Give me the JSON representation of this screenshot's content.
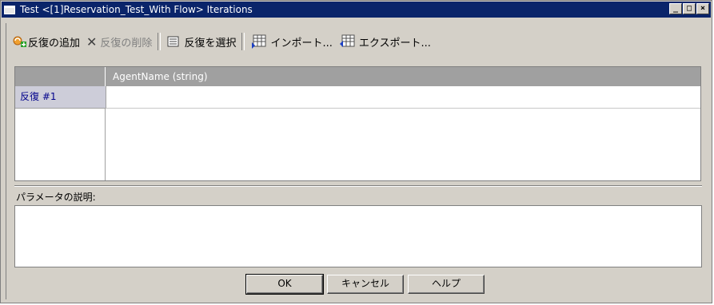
{
  "window": {
    "title": "Test <[1]Reservation_Test_With Flow> Iterations",
    "controls": {
      "minimize": "_",
      "maximize": "□",
      "close": "×"
    }
  },
  "toolbar": {
    "add_iteration": "反復の追加",
    "delete_iteration": "反復の削除",
    "select_iteration": "反復を選択",
    "import": "インポート...",
    "export": "エクスポート..."
  },
  "grid": {
    "columns": [
      "AgentName (string)"
    ],
    "rows": [
      {
        "label": "反復 #1",
        "values": [
          ""
        ]
      }
    ]
  },
  "description": {
    "label": "パラメータの説明:",
    "value": ""
  },
  "buttons": {
    "ok": "OK",
    "cancel": "キャンセル",
    "help": "ヘルプ"
  },
  "colors": {
    "titlebar": "#0a246a",
    "dialog_bg": "#d4d0c8",
    "grid_header": "#a0a0a0",
    "row_header": "#cdcdd9"
  }
}
